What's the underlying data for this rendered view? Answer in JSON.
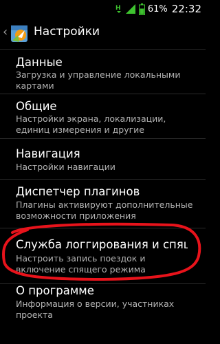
{
  "status_bar": {
    "battery_percent": "61%",
    "time": "22:32",
    "icons": [
      "signal-h-icon",
      "signal-bars-icon",
      "battery-icon"
    ]
  },
  "action_bar": {
    "title": "Настройки",
    "icon": "app-logo-icon"
  },
  "items": [
    {
      "title": "Данные",
      "subtitle": "Загрузка и управление локальными картами"
    },
    {
      "title": "Общие",
      "subtitle": "Настройки экрана, локализации, единиц измерения и другие"
    },
    {
      "title": "Навигация",
      "subtitle": "Настройки навигации"
    },
    {
      "title": "Диспетчер плагинов",
      "subtitle": "Плагины активируют дополнительные возможности приложения"
    },
    {
      "title": "Служба логгирования и спящего режима",
      "subtitle": "Настроить запись поездок и включение спящего режима"
    },
    {
      "title": "О программе",
      "subtitle": "Информация о версии, участниках проекта"
    }
  ],
  "colors": {
    "background": "#000000",
    "status_green": "#3ec32f",
    "highlight_circle": "#e8131b"
  }
}
